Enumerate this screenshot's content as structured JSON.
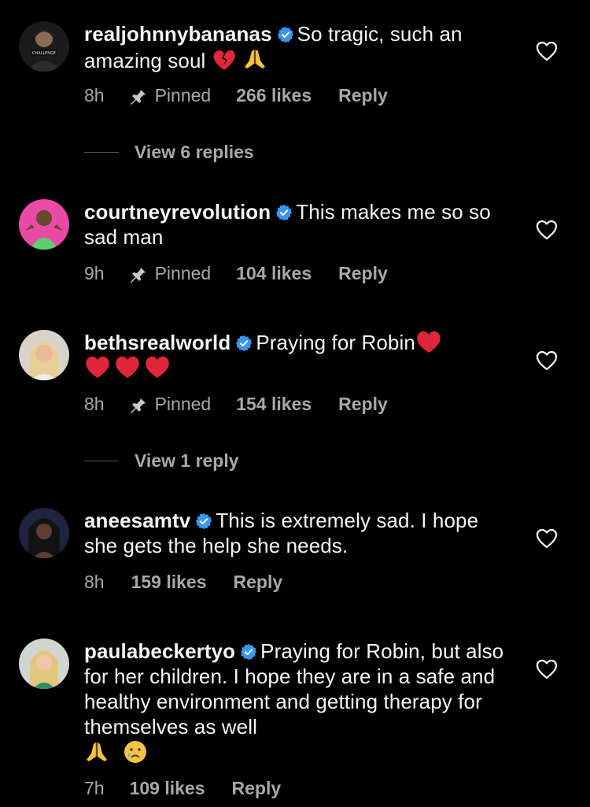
{
  "comments": [
    {
      "username": "realjohnnybananas",
      "text": "So tragic, such an amazing soul",
      "time": "8h",
      "pinned_label": "Pinned",
      "likes": "266 likes",
      "reply": "Reply",
      "replies_label": "View 6 replies"
    },
    {
      "username": "courtneyrevolution",
      "text": "This makes me so so sad man",
      "time": "9h",
      "pinned_label": "Pinned",
      "likes": "104 likes",
      "reply": "Reply"
    },
    {
      "username": "bethsrealworld",
      "text": "Praying for Robin",
      "time": "8h",
      "pinned_label": "Pinned",
      "likes": "154 likes",
      "reply": "Reply",
      "replies_label": "View 1 reply"
    },
    {
      "username": "aneesamtv",
      "text": "This is extremely sad. I hope she gets the help she needs.",
      "time": "8h",
      "likes": "159 likes",
      "reply": "Reply"
    },
    {
      "username": "paulabeckertyo",
      "text": "Praying for Robin, but also for her children.  I hope they are in a safe and healthy environment and getting therapy for themselves as well",
      "time": "7h",
      "likes": "109 likes",
      "reply": "Reply"
    }
  ],
  "icons": {
    "verified": "verified-badge-icon",
    "pin": "pin-icon",
    "heart": "heart-outline-icon",
    "broken_heart": "broken-heart-emoji",
    "pray": "folded-hands-emoji",
    "red_heart": "red-heart-emoji",
    "crying": "crying-face-emoji"
  },
  "colors": {
    "background": "#000000",
    "text": "#f5f5f5",
    "secondary": "#a8a8a8",
    "verified": "#3897f0"
  }
}
